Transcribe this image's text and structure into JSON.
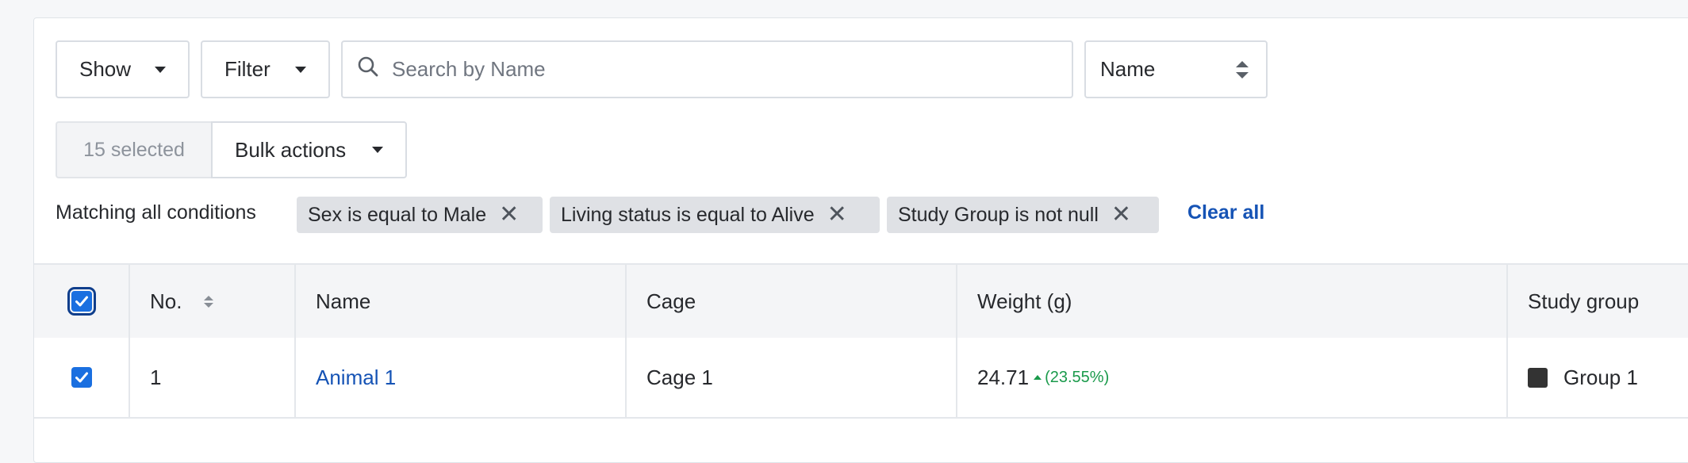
{
  "toolbar": {
    "show_label": "Show",
    "filter_label": "Filter",
    "search_placeholder": "Search by Name",
    "search_value": "",
    "sort_field": "Name"
  },
  "bulk": {
    "selected_count": "15 selected",
    "actions_label": "Bulk actions"
  },
  "conditions": {
    "label": "Matching all conditions",
    "chips": [
      {
        "text": "Sex is equal to Male"
      },
      {
        "text": "Living status is equal to Alive"
      },
      {
        "text": "Study Group is not null"
      }
    ],
    "clear_label": "Clear all"
  },
  "table": {
    "columns": [
      "No.",
      "Name",
      "Cage",
      "Weight (g)",
      "Study group"
    ],
    "rows": [
      {
        "no": "1",
        "name": "Animal 1",
        "cage": "Cage 1",
        "weight": "24.71",
        "weight_change": "(23.55%)",
        "group": "Group 1",
        "group_color": "#333333",
        "checked": true
      }
    ]
  },
  "colors": {
    "accent": "#1a6fe0",
    "link": "#1553b5",
    "positive": "#1a9a4b"
  },
  "icons": {
    "search": "search-icon",
    "caret": "caret-down-icon",
    "remove": "close-icon",
    "sort": "sort-icon"
  }
}
